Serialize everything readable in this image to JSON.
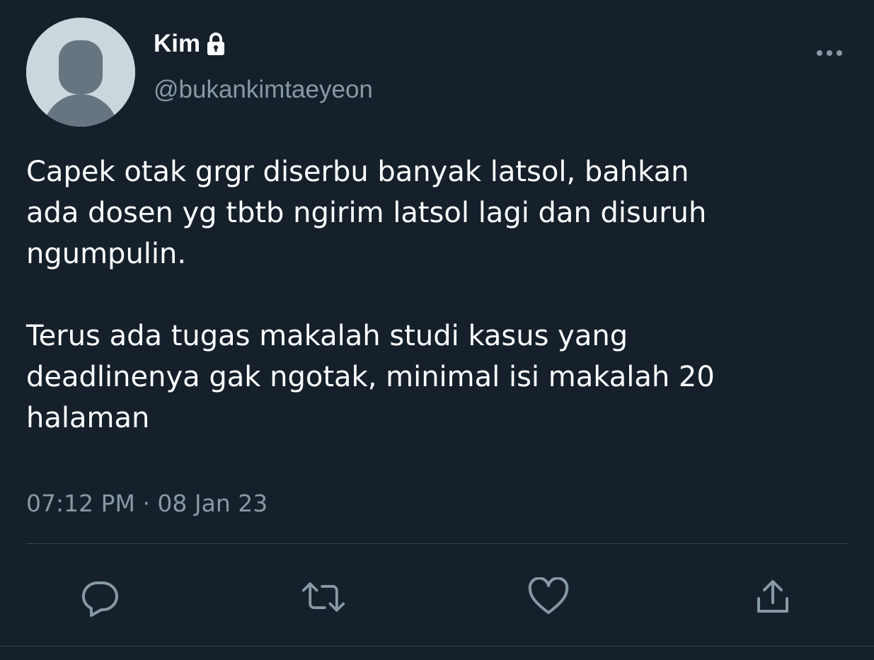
{
  "tweet": {
    "display_name": "Kim",
    "handle": "@bukankimtaeyeon",
    "text": "Capek otak grgr diserbu banyak latsol, bahkan\nada dosen yg tbtb ngirim latsol lagi dan disuruh\nngumpulin.\n\nTerus ada tugas makalah studi kasus yang\ndeadlinenya gak ngotak, minimal isi makalah 20\nhalaman",
    "timestamp": "07:12 PM · 08 Jan 23"
  },
  "icons": {
    "protected": "lock-icon",
    "more": "more-dots-icon",
    "reply": "reply-bubble-icon",
    "retweet": "retweet-icon",
    "like": "heart-icon",
    "share": "share-upload-icon"
  },
  "colors": {
    "background": "#15202b",
    "primary_text": "#ffffff",
    "secondary_text": "#8899a6",
    "divider": "#38444d",
    "avatar_bg": "#ccd6dd",
    "avatar_figure": "#66757f"
  }
}
